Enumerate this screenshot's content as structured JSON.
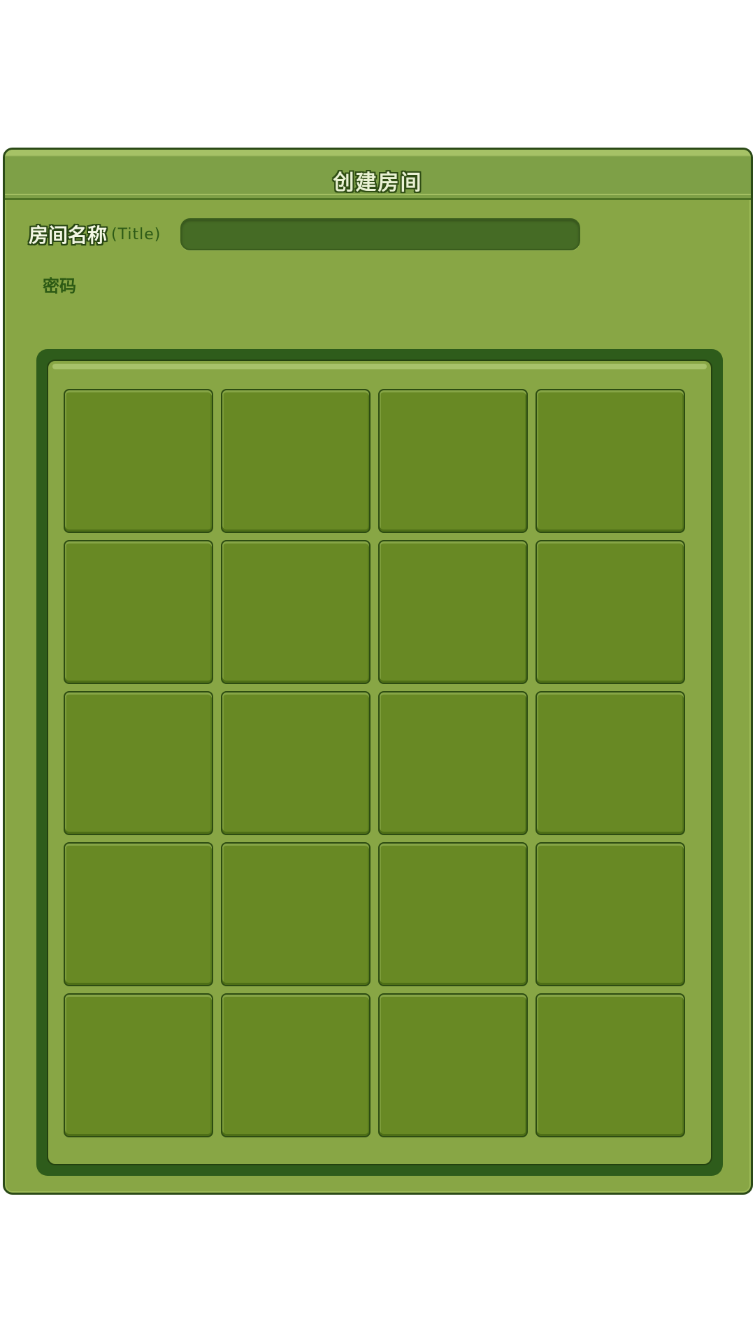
{
  "dialog": {
    "title": "创建房间"
  },
  "room_name": {
    "label": "房间名称",
    "sub_label": "(Title)",
    "value": ""
  },
  "password": {
    "label": "密码"
  },
  "slot_grid": {
    "rows": 5,
    "columns": 4,
    "slots": 20
  },
  "colors": {
    "panel": "#88a645",
    "title_bar": "#7ea047",
    "frame": "#2e5c1b",
    "slot": "#688924",
    "input": "#456b25",
    "border": "#2b4a17"
  }
}
